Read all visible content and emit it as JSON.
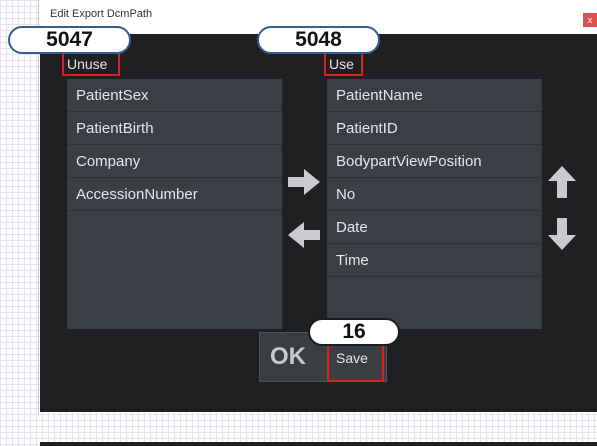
{
  "window": {
    "title": "Edit Export DcmPath",
    "close_label": "x"
  },
  "unuse_panel": {
    "label": "Unuse",
    "items": [
      "PatientSex",
      "PatientBirth",
      "Company",
      "AccessionNumber"
    ]
  },
  "use_panel": {
    "label": "Use",
    "items": [
      "PatientName",
      "PatientID",
      "BodypartViewPosition",
      "No",
      "Date",
      "Time"
    ]
  },
  "buttons": {
    "ok_label": "OK",
    "save_label": "Save"
  },
  "annotations": {
    "unuse_callout": "5047",
    "use_callout": "5048",
    "save_callout": "16"
  },
  "colors": {
    "callout_outline": "#3a5b8f",
    "highlight_box": "#d9211f",
    "dialog_background": "#1e2022"
  }
}
